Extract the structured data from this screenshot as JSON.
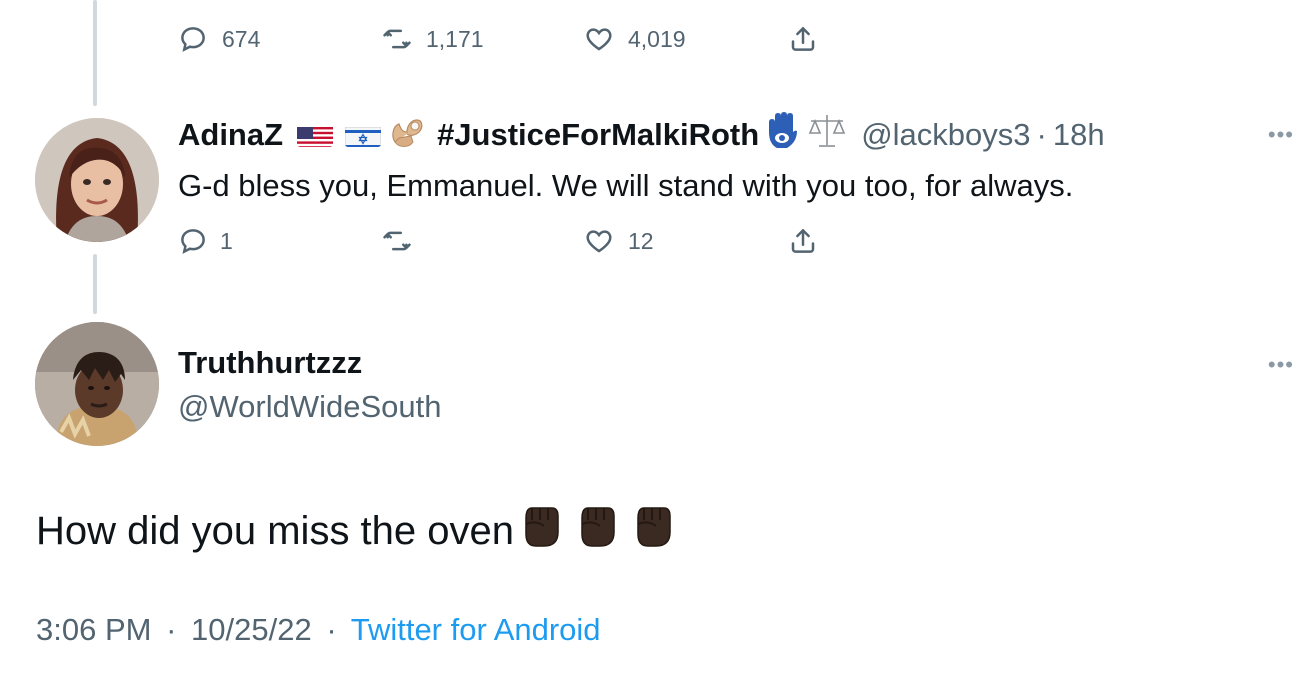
{
  "top_actions": {
    "replies": "674",
    "retweets": "1,171",
    "likes": "4,019"
  },
  "reply1": {
    "display_name": "AdinaZ",
    "hashtag": "#JusticeForMalkiRoth",
    "handle": "@lackboys3",
    "separator": "·",
    "time": "18h",
    "text": "G-d bless you, Emmanuel. We will stand with you too, for always.",
    "replies": "1",
    "retweets": "",
    "likes": "12",
    "more": "•••"
  },
  "main_tweet": {
    "display_name": "Truthhurtzzz",
    "handle": "@WorldWideSouth",
    "text": "How did you miss the oven",
    "time": "3:06 PM",
    "separator1": "·",
    "date": "10/25/22",
    "separator2": "·",
    "source": "Twitter for Android",
    "more": "•••"
  },
  "colors": {
    "text": "#0f1419",
    "muted": "#536471",
    "link": "#1d9bf0",
    "thread_line": "#cfd9de"
  },
  "icons": [
    "reply-icon",
    "retweet-icon",
    "like-icon",
    "share-icon",
    "more-icon",
    "us-flag-icon",
    "israel-flag-icon",
    "ok-hand-emoji-icon",
    "hamsa-emoji-icon",
    "scales-emoji-icon",
    "raised-fist-emoji-icon"
  ]
}
